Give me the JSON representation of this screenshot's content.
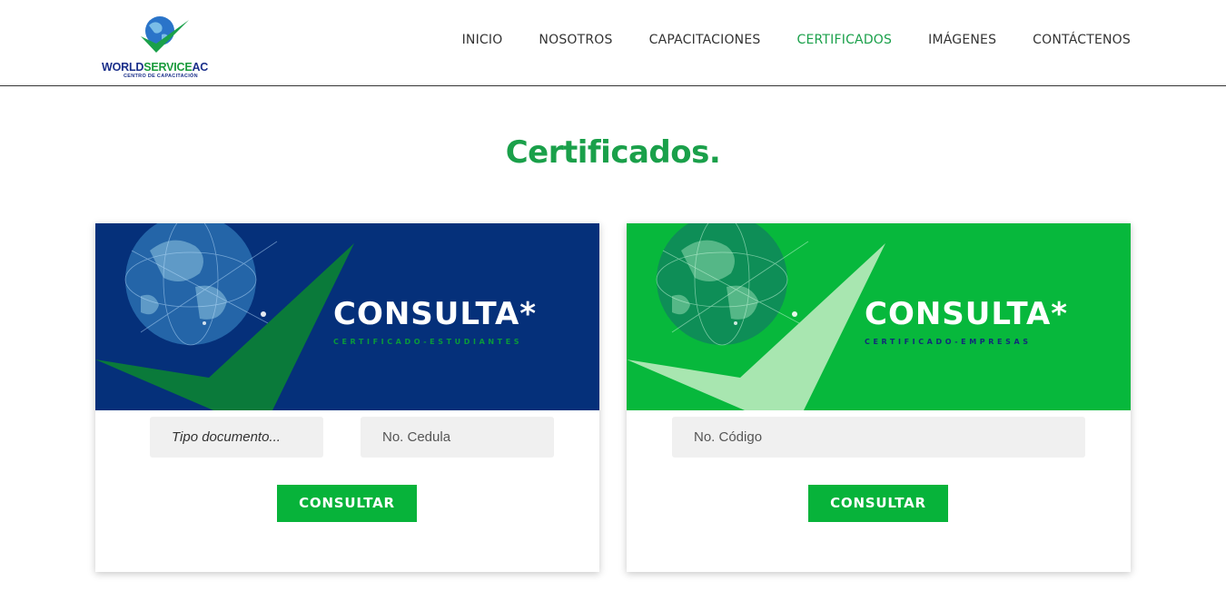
{
  "header": {
    "logo": {
      "name": "WORLDSERVICEAC",
      "name_part1": "WORLD",
      "name_part2": "SERVICE",
      "name_part3": "AC",
      "tagline": "CENTRO DE CAPACITACIÓN"
    },
    "nav": [
      {
        "label": "INICIO",
        "active": false
      },
      {
        "label": "NOSOTROS",
        "active": false
      },
      {
        "label": "CAPACITACIONES",
        "active": false
      },
      {
        "label": "CERTIFICADOS",
        "active": true
      },
      {
        "label": "IMÁGENES",
        "active": false
      },
      {
        "label": "CONTÁCTENOS",
        "active": false
      }
    ]
  },
  "main": {
    "title": "Certificados."
  },
  "cards": [
    {
      "banner_title": "CONSULTA*",
      "banner_subtitle": "CERTIFICADO-ESTUDIANTES",
      "banner_bg": "#05307a",
      "fields": [
        {
          "placeholder": "Tipo documento...",
          "type": "select"
        },
        {
          "placeholder": "No. Cedula",
          "type": "text"
        }
      ],
      "button_label": "CONSULTAR"
    },
    {
      "banner_title": "CONSULTA*",
      "banner_subtitle": "CERTIFICADO-EMPRESAS",
      "banner_bg": "#07b83c",
      "fields": [
        {
          "placeholder": "No. Código",
          "type": "text"
        }
      ],
      "button_label": "CONSULTAR"
    }
  ],
  "colors": {
    "accent_green": "#1aa04a",
    "button_green": "#07b33a",
    "brand_blue": "#1a2f8a"
  }
}
